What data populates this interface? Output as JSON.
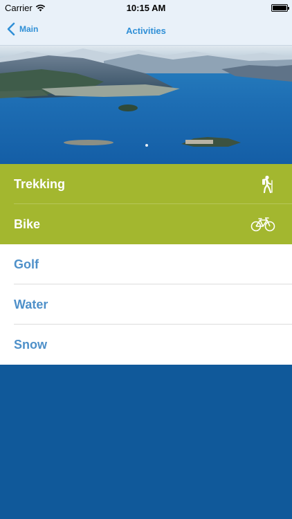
{
  "status_bar": {
    "carrier": "Carrier",
    "time": "10:15 AM"
  },
  "nav": {
    "back_label": "Main",
    "title": "Activities"
  },
  "activities": [
    {
      "label": "Trekking",
      "style": "green",
      "icon": "hiker-icon"
    },
    {
      "label": "Bike",
      "style": "green",
      "icon": "bicycle-icon"
    },
    {
      "label": "Golf",
      "style": "white",
      "icon": ""
    },
    {
      "label": "Water",
      "style": "white",
      "icon": ""
    },
    {
      "label": "Snow",
      "style": "white",
      "icon": ""
    }
  ],
  "colors": {
    "accent_blue": "#2f8fd6",
    "green": "#a3b72f",
    "list_text_blue": "#4e90c9",
    "background_blue": "#10599a",
    "nav_background": "#e9f1f9"
  }
}
